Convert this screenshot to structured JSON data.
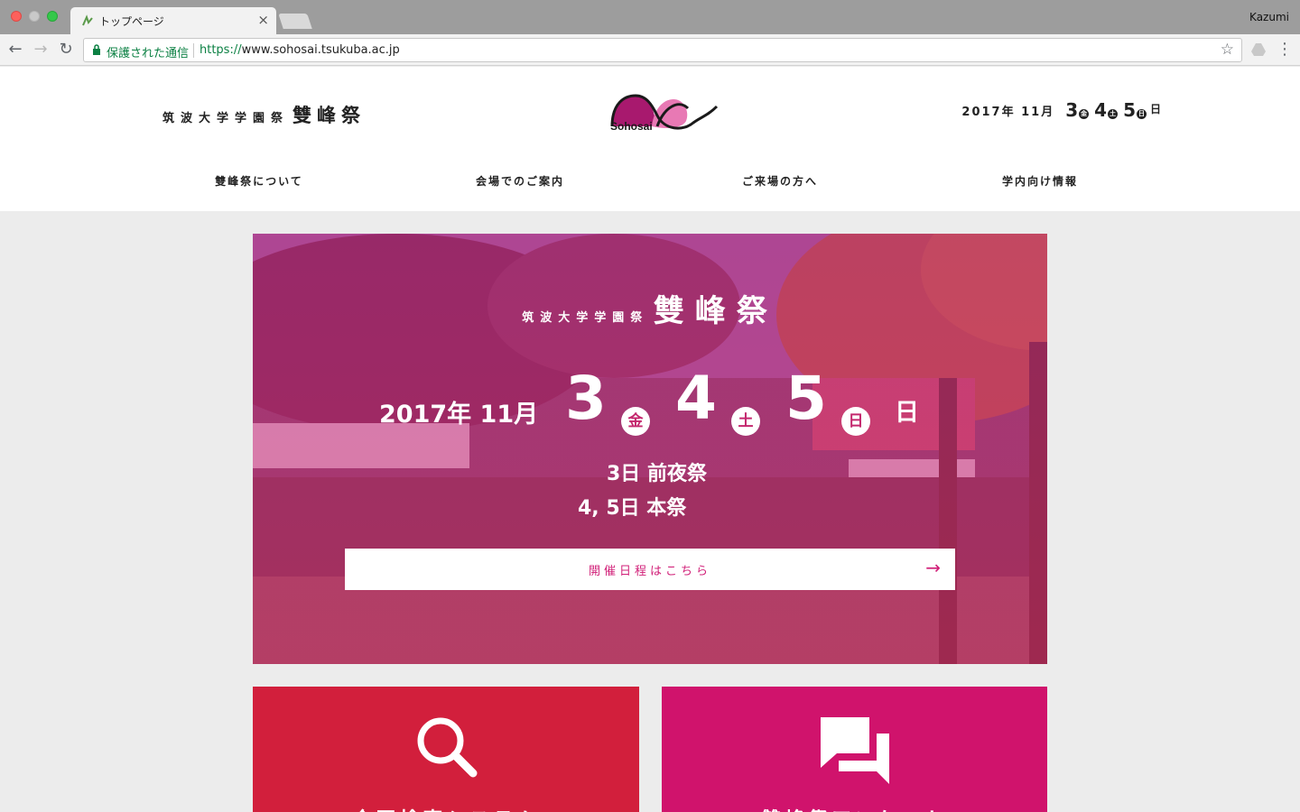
{
  "browser": {
    "tab_title": "トップページ",
    "tab_close": "×",
    "profile_name": "Kazumi",
    "secure_label": "保護された通信",
    "url_scheme": "https://",
    "url_host": "www.sohosai.tsukuba.ac.jp",
    "back": "←",
    "forward": "→",
    "reload": "↻",
    "bookmark_star": "☆",
    "menu": "⋮"
  },
  "header": {
    "brand_small": "筑波大学学園祭",
    "brand_big": "雙峰祭",
    "logo_text": "Sohosai",
    "date_year_month": "2017年 11月",
    "days": [
      {
        "day": "3",
        "dow": "金"
      },
      {
        "day": "4",
        "dow": "土"
      },
      {
        "day": "5",
        "dow": "日"
      }
    ],
    "date_suffix": "日"
  },
  "nav": {
    "items": [
      {
        "label": "雙峰祭について"
      },
      {
        "label": "会場でのご案内"
      },
      {
        "label": "ご来場の方へ"
      },
      {
        "label": "学内向け情報"
      }
    ]
  },
  "hero": {
    "title_small": "筑波大学学園祭",
    "title_big": "雙峰祭",
    "year_month": "2017年 11月",
    "days": [
      {
        "day": "3",
        "dow": "金"
      },
      {
        "day": "4",
        "dow": "土"
      },
      {
        "day": "5",
        "dow": "日"
      }
    ],
    "suffix": "日",
    "sub_line1": "3日 前夜祭",
    "sub_line2": "4, 5日 本祭",
    "cta_label": "開催日程はこちら",
    "cta_arrow": "→"
  },
  "cards": [
    {
      "title": "企画検索システム",
      "icon": "search-icon",
      "color": "#d21f3c"
    },
    {
      "title": "雙峰祭アンケート",
      "icon": "chat-icon",
      "color": "#d0136c"
    }
  ],
  "colors": {
    "brand_pink": "#d11f78",
    "card_red": "#d21f3c",
    "card_pink": "#d0136c"
  }
}
